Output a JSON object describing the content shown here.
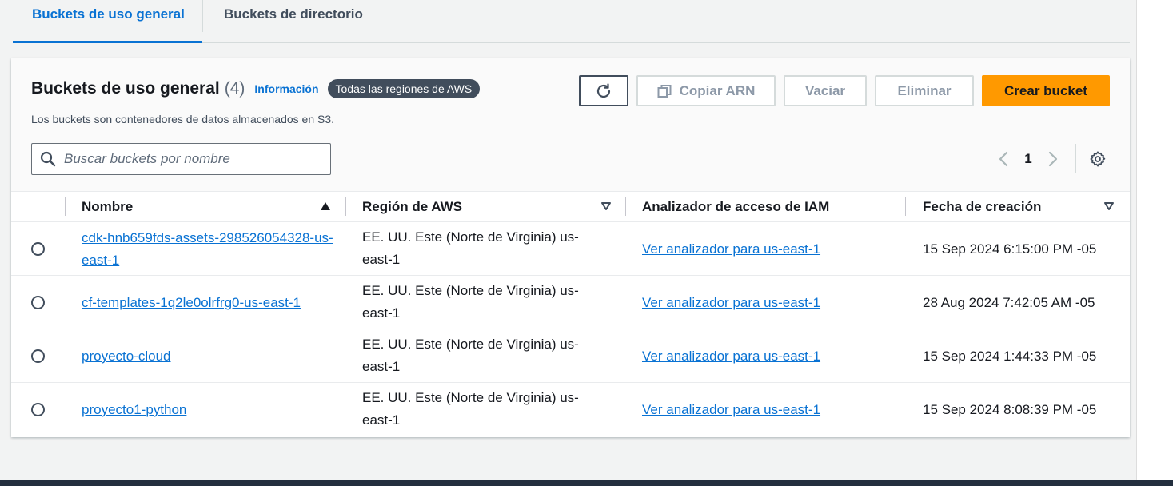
{
  "tabs": [
    {
      "label": "Buckets de uso general",
      "active": true
    },
    {
      "label": "Buckets de directorio",
      "active": false
    }
  ],
  "header": {
    "title": "Buckets de uso general",
    "count": "(4)",
    "info_link": "Información",
    "region_badge": "Todas las regiones de AWS",
    "subtitle": "Los buckets son contenedores de datos almacenados en S3."
  },
  "actions": {
    "refresh_icon": "refresh-icon",
    "copy_arn": "Copiar ARN",
    "empty": "Vaciar",
    "delete": "Eliminar",
    "create": "Crear bucket"
  },
  "search": {
    "placeholder": "Buscar buckets por nombre",
    "value": ""
  },
  "pagination": {
    "current_page": "1"
  },
  "table": {
    "columns": [
      {
        "label": "Nombre",
        "sort": "ascending"
      },
      {
        "label": "Región de AWS",
        "sort": "sortable"
      },
      {
        "label": "Analizador de acceso de IAM",
        "sort": "none"
      },
      {
        "label": "Fecha de creación",
        "sort": "sortable"
      }
    ],
    "rows": [
      {
        "name": "cdk-hnb659fds-assets-298526054328-us-east-1",
        "region": "EE. UU. Este (Norte de Virginia) us-east-1",
        "iam": "Ver analizador para us-east-1",
        "created": "15 Sep 2024 6:15:00 PM -05"
      },
      {
        "name": "cf-templates-1q2le0olrfrg0-us-east-1",
        "region": "EE. UU. Este (Norte de Virginia) us-east-1",
        "iam": "Ver analizador para us-east-1",
        "created": "28 Aug 2024 7:42:05 AM -05"
      },
      {
        "name": "proyecto-cloud",
        "region": "EE. UU. Este (Norte de Virginia) us-east-1",
        "iam": "Ver analizador para us-east-1",
        "created": "15 Sep 2024 1:44:33 PM -05"
      },
      {
        "name": "proyecto1-python",
        "region": "EE. UU. Este (Norte de Virginia) us-east-1",
        "iam": "Ver analizador para us-east-1",
        "created": "15 Sep 2024 8:08:39 PM -05"
      }
    ]
  },
  "colors": {
    "accent": "#0972d3",
    "primary_button": "#ff9900",
    "badge": "#414d5c"
  }
}
